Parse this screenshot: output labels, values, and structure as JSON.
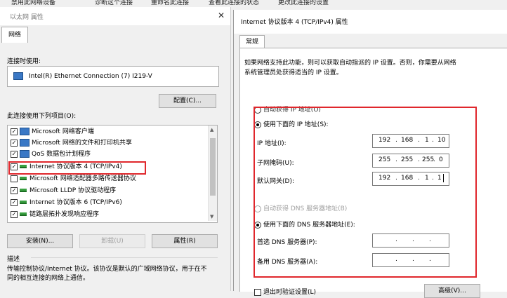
{
  "topbar": {
    "items": [
      "禁用此网络设备",
      "诊断这个连接",
      "重命名此连接",
      "查看此连接的状态",
      "更改此连接的设置"
    ]
  },
  "left_dialog": {
    "title": "以太网 属性",
    "close": "✕",
    "tab": "网络",
    "connect_using_label": "连接时使用:",
    "adapter": "Intel(R) Ethernet Connection (7) I219-V",
    "configure_button": "配置(C)...",
    "items_label": "此连接使用下列项目(O):",
    "items": [
      {
        "label": "Microsoft 网络客户端",
        "checked": true,
        "icon": "network-icon"
      },
      {
        "label": "Microsoft 网络的文件和打印机共享",
        "checked": true,
        "icon": "network-icon"
      },
      {
        "label": "QoS 数据包计划程序",
        "checked": true,
        "icon": "network-icon"
      },
      {
        "label": "Internet 协议版本 4 (TCP/IPv4)",
        "checked": true,
        "icon": "protocol-icon"
      },
      {
        "label": "Microsoft 网络适配器多路传送器协议",
        "checked": false,
        "icon": "protocol-icon"
      },
      {
        "label": "Microsoft LLDP 协议驱动程序",
        "checked": true,
        "icon": "protocol-icon"
      },
      {
        "label": "Internet 协议版本 6 (TCP/IPv6)",
        "checked": true,
        "icon": "protocol-icon"
      },
      {
        "label": "链路层拓扑发现响应程序",
        "checked": true,
        "icon": "protocol-icon"
      }
    ],
    "install_button": "安装(N)...",
    "uninstall_button": "卸载(U)",
    "properties_button": "属性(R)",
    "description_label": "描述",
    "description_text": "传输控制协议/Internet 协议。该协议是默认的广域网络协议，用于在不同的相互连接的网络上通信。"
  },
  "right_dialog": {
    "title": "Internet 协议版本 4 (TCP/IPv4) 属性",
    "tab": "常规",
    "intro": "如果网络支持此功能，则可以获取自动指派的 IP 设置。否则，你需要从网络系统管理员处获得适当的 IP 设置。",
    "auto_ip_label": "自动获得 IP 地址(O)",
    "manual_ip_label": "使用下面的 IP 地址(S):",
    "ip_address_label": "IP 地址(I):",
    "ip_address": [
      "192",
      "168",
      "1",
      "10"
    ],
    "subnet_label": "子网掩码(U):",
    "subnet": [
      "255",
      "255",
      "255",
      "0"
    ],
    "gateway_label": "默认网关(D):",
    "gateway": [
      "192",
      "168",
      "1",
      "1"
    ],
    "auto_dns_label": "自动获得 DNS 服务器地址(B)",
    "manual_dns_label": "使用下面的 DNS 服务器地址(E):",
    "preferred_dns_label": "首选 DNS 服务器(P):",
    "alternate_dns_label": "备用 DNS 服务器(A):",
    "validate_label": "退出时验证设置(L)",
    "advanced_button": "高级(V)...",
    "dot": "."
  },
  "colors": {
    "highlight_red": "#e0272c"
  }
}
